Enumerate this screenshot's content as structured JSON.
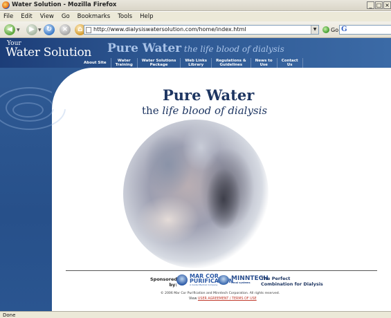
{
  "window": {
    "title": "Water Solution - Mozilla Firefox",
    "controls": [
      "_",
      "□",
      "×"
    ]
  },
  "menu": [
    "File",
    "Edit",
    "View",
    "Go",
    "Bookmarks",
    "Tools",
    "Help"
  ],
  "toolbar": {
    "url": "http://www.dialysiswatersolution.com/home/index.html",
    "go_label": "Go",
    "search_placeholder": "G"
  },
  "site": {
    "logo_top": "Your",
    "logo_main": "Water Solution",
    "tagline_bold": "Pure Water",
    "tagline_italic": " the life blood of dialysis",
    "nav": [
      "About Site",
      "Water\nTraining",
      "Water Solutions\nPackage",
      "Web Links\nLibrary",
      "Regulations &\nGuidelines",
      "News to\nUse",
      "Contact\nUs"
    ],
    "hero_title": "Pure Water",
    "hero_sub_prefix": "the ",
    "hero_sub_italic": "life blood of dialysis",
    "sponsored_line1": "Sponsored",
    "sponsored_line2": "by:",
    "marcor_name": "MAR COR",
    "marcor_sub": "PURIFICATION",
    "marcor_tag": "A Cantel Medical Company",
    "minntech_name": "MINNTECH",
    "minntech_tag": "renal systems",
    "perfect_line1": "The Perfect",
    "perfect_line2": "Combination for Dialysis",
    "copyright": "© 2006 Mar Cor Purification and Minntech Corporation. All rights reserved.",
    "view_prefix": "View ",
    "view_link": "USER AGREEMENT / TERMS OF USE"
  },
  "status": "Done"
}
